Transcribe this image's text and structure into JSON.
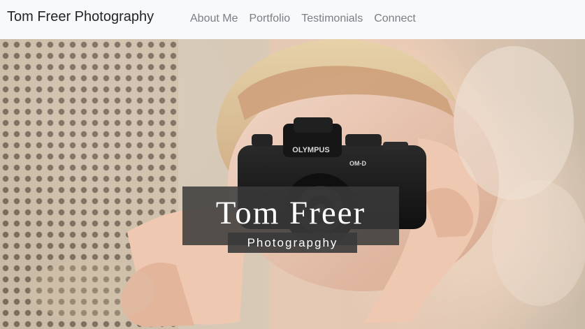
{
  "navbar": {
    "brand": "Tom Freer Photography",
    "links": [
      "About Me",
      "Portfolio",
      "Testimonials",
      "Connect"
    ]
  },
  "hero": {
    "title": "Tom Freer",
    "subtitle": "Photograpghy",
    "camera_brand_text": "OLYMPUS",
    "camera_model_text": "OM-D"
  },
  "colors": {
    "navbar_background": "#f8f9fa",
    "nav_link_text": "#7a7f86",
    "overlay_box": "#3a3a3a",
    "overlay_text": "#ffffff"
  },
  "icons": {
    "camera": "camera-icon"
  }
}
